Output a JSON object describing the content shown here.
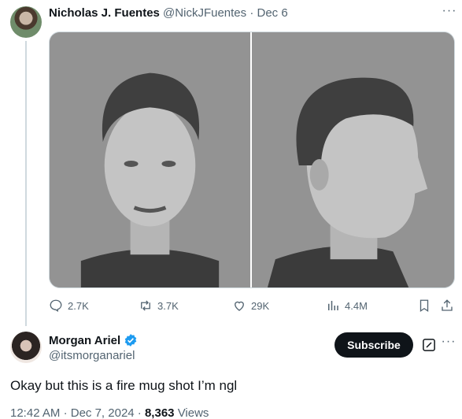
{
  "original_tweet": {
    "author_name": "Nicholas J. Fuentes",
    "handle": "@NickJFuentes",
    "separator": "·",
    "date": "Dec 6",
    "more_glyph": "···",
    "actions": {
      "replies": "2.7K",
      "reposts": "3.7K",
      "likes": "29K",
      "views": "4.4M"
    }
  },
  "reply": {
    "author_name": "Morgan Ariel",
    "handle": "@itsmorganariel",
    "subscribe_label": "Subscribe",
    "more_glyph": "···",
    "text": "Okay but this is a fire mug shot I’m ngl",
    "time": "12:42 AM",
    "date": "Dec 7, 2024",
    "dot": "·",
    "views_count": "8,363",
    "views_label": "Views"
  },
  "colors": {
    "text_primary": "#0f1419",
    "text_secondary": "#536471",
    "verified_blue": "#1d9bf0",
    "border": "#cfd9de"
  },
  "icons": [
    "reply-icon",
    "repost-icon",
    "like-icon",
    "views-icon",
    "bookmark-icon",
    "share-icon",
    "verified-icon",
    "grok-icon",
    "more-icon"
  ]
}
